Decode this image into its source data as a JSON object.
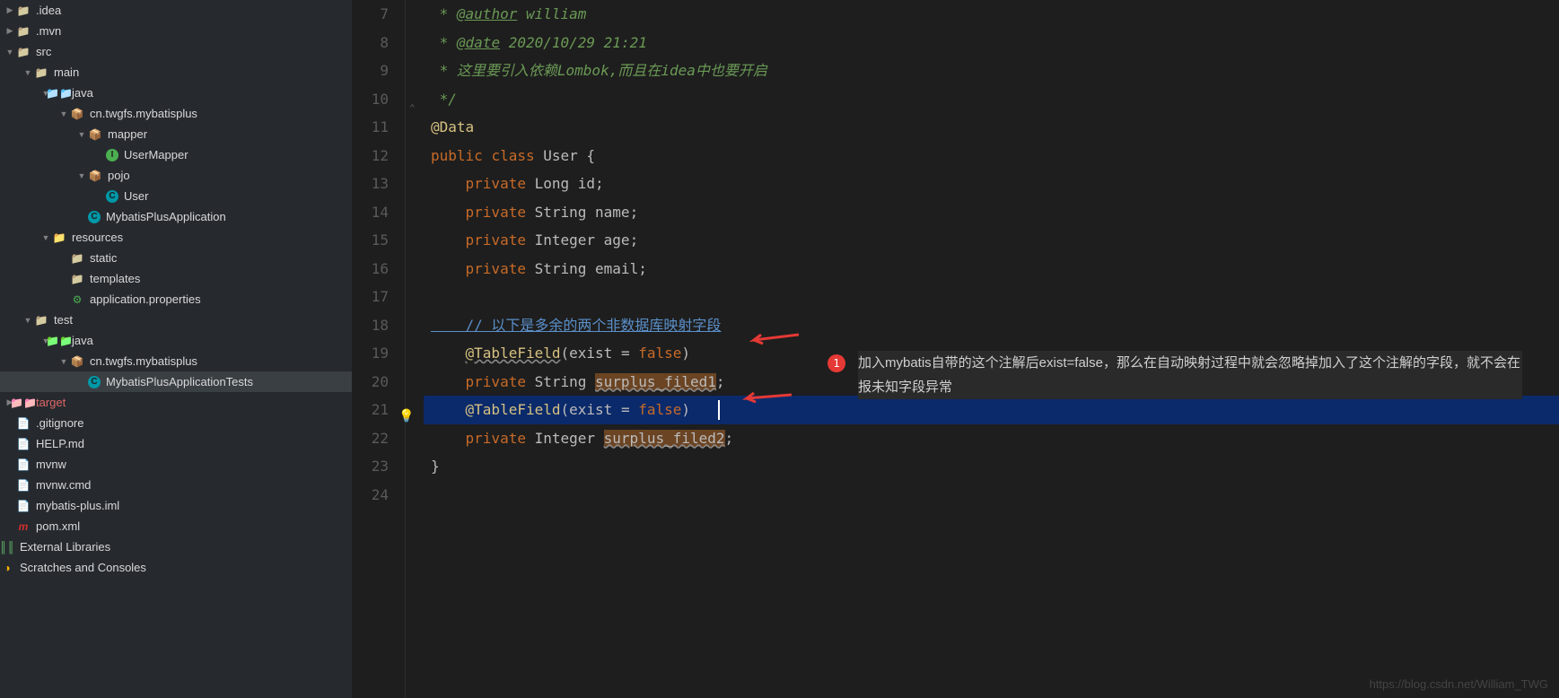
{
  "tree": {
    "idea": ".idea",
    "mvn": ".mvn",
    "src": "src",
    "main": "main",
    "java1": "java",
    "pkg1": "cn.twgfs.mybatisplus",
    "mapper": "mapper",
    "usermapper": "UserMapper",
    "pojo": "pojo",
    "user": "User",
    "app": "MybatisPlusApplication",
    "resources": "resources",
    "static": "static",
    "templates": "templates",
    "appprops": "application.properties",
    "test": "test",
    "java2": "java",
    "pkg2": "cn.twgfs.mybatisplus",
    "apptests": "MybatisPlusApplicationTests",
    "target": "target",
    "gitignore": ".gitignore",
    "help": "HELP.md",
    "mvnw": "mvnw",
    "mvnwcmd": "mvnw.cmd",
    "iml": "mybatis-plus.iml",
    "pom": "pom.xml",
    "extlib": "External Libraries",
    "scratches": "Scratches and Consoles"
  },
  "gutter": [
    "7",
    "8",
    "9",
    "10",
    "11",
    "12",
    "13",
    "14",
    "15",
    "16",
    "17",
    "18",
    "19",
    "20",
    "21",
    "22",
    "23",
    "24"
  ],
  "code": {
    "l7a": " * ",
    "l7b": "@author",
    "l7c": " william",
    "l8a": " * ",
    "l8b": "@date",
    "l8c": " 2020/10/29 21:21",
    "l9": " * 这里要引入依赖Lombok,而且在idea中也要开启",
    "l10": " */",
    "l11": "@Data",
    "l12a": "public ",
    "l12b": "class ",
    "l12c": "User ",
    "l12d": "{",
    "l13a": "    private ",
    "l13b": "Long ",
    "l13c": "id",
    "l13d": ";",
    "l14a": "    private ",
    "l14b": "String ",
    "l14c": "name",
    "l14d": ";",
    "l15a": "    private ",
    "l15b": "Integer ",
    "l15c": "age",
    "l15d": ";",
    "l16a": "    private ",
    "l16b": "String ",
    "l16c": "email",
    "l16d": ";",
    "l18": "    // 以下是多余的两个非数据库映射字段",
    "l19a": "    ",
    "l19b": "@TableField",
    "l19c": "(",
    "l19d": "exist ",
    "l19e": "= ",
    "l19f": "false",
    "l19g": ")",
    "l20a": "    private ",
    "l20b": "String ",
    "l20c": "surplus_filed1",
    "l20d": ";",
    "l21a": "    ",
    "l21b": "@TableField",
    "l21c": "(",
    "l21d": "exist ",
    "l21e": "= ",
    "l21f": "false",
    "l21g": ")",
    "l22a": "    private ",
    "l22b": "Integer ",
    "l22c": "surplus_filed2",
    "l22d": ";",
    "l23": "}"
  },
  "annotation": {
    "badge": "1",
    "text": "加入mybatis自带的这个注解后exist=false，那么在自动映射过程中就会忽略掉加入了这个注解的字段，就不会在报未知字段异常"
  },
  "watermark": "https://blog.csdn.net/William_TWG"
}
